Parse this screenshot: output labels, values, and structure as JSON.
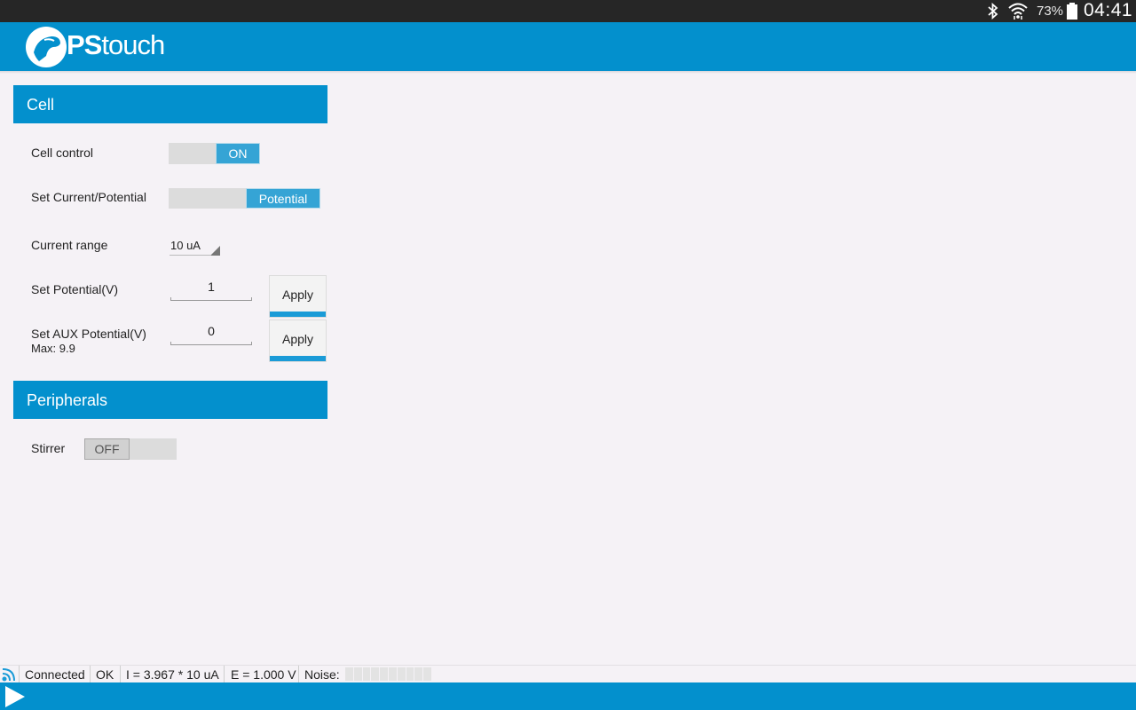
{
  "system_status": {
    "battery_percent": "73%",
    "time": "04:41"
  },
  "app": {
    "logo_ps": "PS",
    "logo_touch": "touch"
  },
  "cell_section": {
    "title": "Cell",
    "cell_control_label": "Cell control",
    "cell_control_value": "ON",
    "set_mode_label": "Set Current/Potential",
    "set_mode_value": "Potential",
    "current_range_label": "Current range",
    "current_range_value": "10 uA",
    "set_potential_label": "Set Potential(V)",
    "set_potential_value": "1",
    "apply_label": "Apply",
    "set_aux_label": "Set AUX Potential(V)",
    "set_aux_max": "Max: 9.9",
    "set_aux_value": "0"
  },
  "peripherals_section": {
    "title": "Peripherals",
    "stirrer_label": "Stirrer",
    "stirrer_value": "OFF"
  },
  "status_row": {
    "connection": "Connected",
    "state": "OK",
    "current": "I = 3.967 * 10 uA",
    "potential": "E = 1.000 V",
    "noise_label": "Noise:"
  },
  "colors": {
    "accent": "#0390cd",
    "toggle_on": "#35a4d5",
    "background": "#f5f2f6"
  },
  "icons": [
    "bluetooth-icon",
    "wifi-icon",
    "battery-icon",
    "pstouch-logo-icon",
    "signal-icon",
    "play-icon"
  ]
}
